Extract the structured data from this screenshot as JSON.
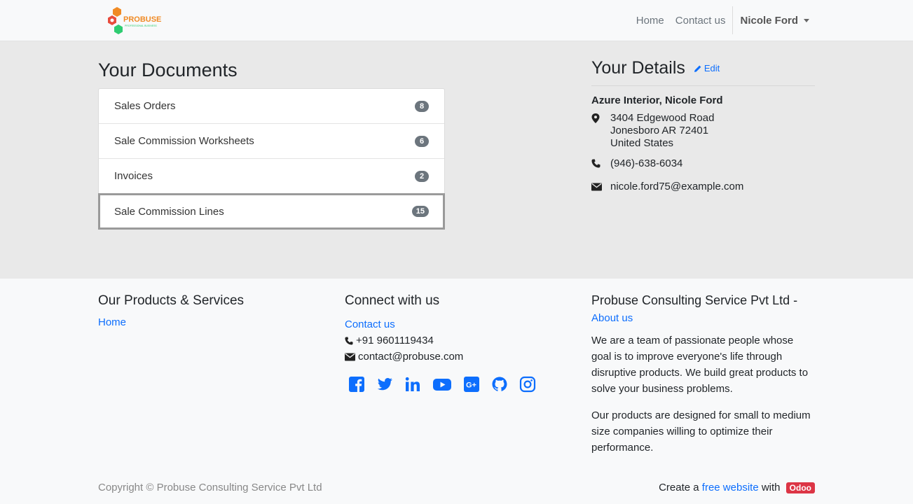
{
  "brand": {
    "name": "PROBUSE",
    "tagline": "PROFESSIONAL BUSINESS"
  },
  "nav": {
    "home": "Home",
    "contact": "Contact us",
    "user": "Nicole Ford"
  },
  "documents": {
    "title": "Your Documents",
    "items": [
      {
        "label": "Sales Orders",
        "count": "8"
      },
      {
        "label": "Sale Commission Worksheets",
        "count": "6"
      },
      {
        "label": "Invoices",
        "count": "2"
      },
      {
        "label": "Sale Commission Lines",
        "count": "15"
      }
    ]
  },
  "details": {
    "title": "Your Details",
    "edit": "Edit",
    "company": "Azure Interior, Nicole Ford",
    "address": [
      "3404 Edgewood Road",
      "Jonesboro AR 72401",
      "United States"
    ],
    "phone": "(946)-638-6034",
    "email": "nicole.ford75@example.com"
  },
  "footer": {
    "products_title": "Our Products & Services",
    "products_home": "Home",
    "connect_title": "Connect with us",
    "contact_link": "Contact us",
    "phone": "+91 9601119434",
    "email": "contact@probuse.com",
    "socials": [
      "facebook-icon",
      "twitter-icon",
      "linkedin-icon",
      "youtube-icon",
      "google-plus-icon",
      "github-icon",
      "instagram-icon"
    ],
    "about_company": "Probuse Consulting Service Pvt Ltd",
    "about_sep": " - ",
    "about_link": "About us",
    "about_p1": "We are a team of passionate people whose goal is to improve everyone's life through disruptive products. We build great products to solve your business problems.",
    "about_p2": "Our products are designed for small to medium size companies willing to optimize their performance.",
    "copyright": "Copyright © Probuse Consulting Service Pvt Ltd",
    "created_prefix": "Create a ",
    "created_link": "free website",
    "created_mid": " with ",
    "odoo": "Odoo"
  },
  "colors": {
    "link": "#0d6efd",
    "badge": "#6c757d",
    "odoo": "#dc3545"
  }
}
